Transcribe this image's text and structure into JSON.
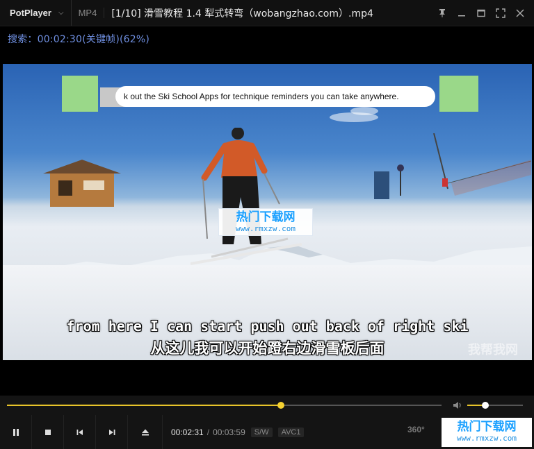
{
  "app": {
    "name": "PotPlayer",
    "format": "MP4",
    "title": "[1/10] 滑雪教程  1.4 犁式转弯（wobangzhao.com）.mp4"
  },
  "osd": {
    "text": "搜索：00:02:30(关键帧)(62%)",
    "color": "#6f8fe0"
  },
  "video": {
    "banner_text": "k out the Ski School Apps for technique reminders you can take anywhere.",
    "subtitle_en": "from here I can start push out back of right ski",
    "subtitle_cn": "从这儿我可以开始蹬右边滑雪板后面",
    "watermark_corner": "我帮我网",
    "watermark_center": {
      "line1": "热门下载网",
      "line2": "www.rmxzw.com"
    }
  },
  "seek": {
    "progress": 0.63,
    "color": "#e7c32a"
  },
  "volume": {
    "level": 0.33
  },
  "controls": {
    "buttons": [
      "pause-icon",
      "stop-icon",
      "previous-icon",
      "next-icon",
      "eject-icon"
    ],
    "current_time": "00:02:31",
    "separator": "/",
    "duration": "00:03:59",
    "tag_sw": "S/W",
    "tag_codec": "AVC1",
    "vr_label": "360°"
  },
  "watermark_bottom": {
    "line1": "热门下载网",
    "line2": "www.rmxzw.com"
  }
}
